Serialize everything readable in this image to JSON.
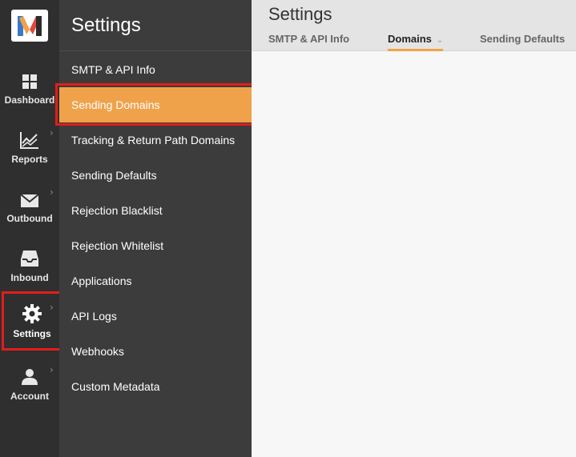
{
  "rail": {
    "logo_letter": "M",
    "items": [
      {
        "label": "Dashboard",
        "icon": "grid-icon",
        "has_chevron": false
      },
      {
        "label": "Reports",
        "icon": "chart-icon",
        "has_chevron": true
      },
      {
        "label": "Outbound",
        "icon": "envelope-icon",
        "has_chevron": true
      },
      {
        "label": "Inbound",
        "icon": "inbox-icon",
        "has_chevron": false
      },
      {
        "label": "Settings",
        "icon": "gear-icon",
        "has_chevron": true
      },
      {
        "label": "Account",
        "icon": "user-icon",
        "has_chevron": true
      }
    ],
    "chevron_glyph": "›"
  },
  "submenu": {
    "title": "Settings",
    "items": [
      {
        "label": "SMTP & API Info"
      },
      {
        "label": "Sending Domains",
        "active": true
      },
      {
        "label": "Tracking & Return Path Domains"
      },
      {
        "label": "Sending Defaults"
      },
      {
        "label": "Rejection Blacklist"
      },
      {
        "label": "Rejection Whitelist"
      },
      {
        "label": "Applications"
      },
      {
        "label": "API Logs"
      },
      {
        "label": "Webhooks"
      },
      {
        "label": "Custom Metadata"
      }
    ]
  },
  "main": {
    "title": "Settings",
    "tabs": [
      {
        "label": "SMTP & API Info"
      },
      {
        "label": "Domains",
        "active": true,
        "dropdown": "⌄"
      },
      {
        "label": "Sending Defaults"
      }
    ]
  },
  "colors": {
    "accent": "#f0a24a",
    "rail_bg": "#2f2f2f",
    "submenu_bg": "#3c3c3c",
    "highlight": "#e11d1d"
  }
}
